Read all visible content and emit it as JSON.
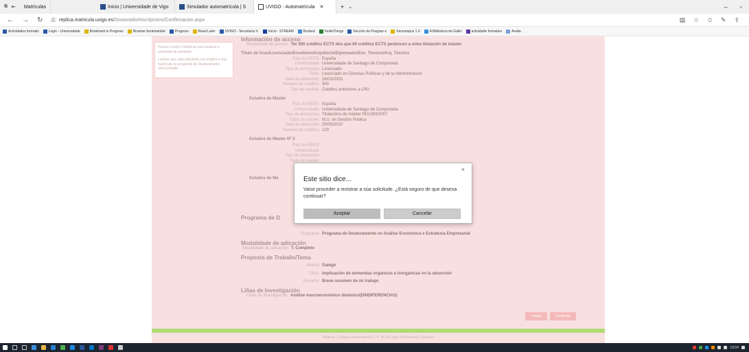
{
  "browser": {
    "tabs": [
      {
        "label": "Matrículas",
        "active": false
      },
      {
        "label": "Inicio | Universidade de Vigo",
        "active": false
      },
      {
        "label": "Simulador automatrícula | S",
        "active": false
      },
      {
        "label": "UVIGO - Automatrícula",
        "active": true
      }
    ],
    "url_host": "replica.matricula.uvigo.es",
    "url_path": "/Doutorado/Inscripcions/Confirmacion.aspx",
    "favorites": [
      "Actividades formativ",
      "Login - Universidade",
      "Bookmark in Progress",
      "Browser bookmarklet",
      "Progress",
      "Read Later",
      "UVIGO - Secretaría V.",
      "Inicio - STREAM",
      "Booked",
      "FeideThings",
      "Sección de Posgrao e",
      "Xescampus 1.0",
      "A Biblioteca de Galici",
      "actividade formativa",
      "Avalia"
    ]
  },
  "sidebar": {
    "text1": "Prema o botón Confirmar para realizar a solicitude de admisión.",
    "text2": "Lembre que esta solicitude non implica a súa matrícula no programa de Doutoramento seleccionado."
  },
  "main": {
    "access_title": "Información de acceso",
    "access_mode_label": "Modalidade de acceso:",
    "access_mode_value": "Ter 300 créditos ECTS dos que 60 créditos ECTS pertencen a unha titulación de máster",
    "grade_title": "Título de Grao/Licenciado/Enxeñeiro/Arquitecto/Diplomado/Enx. Técnico/Arq. Técnico",
    "grade_rows": [
      {
        "label": "País do EEES:",
        "value": "España"
      },
      {
        "label": "Universidade:",
        "value": "Universidade de Santiago de Compostela"
      },
      {
        "label": "Tipo de ensinanza:",
        "value": "Licenciado"
      },
      {
        "label": "Título:",
        "value": "Licenciado en Ciencias Políticas y de la Administración"
      },
      {
        "label": "Data de obtención:",
        "value": "26/03/2003"
      },
      {
        "label": "Número de créditos:",
        "value": "300"
      },
      {
        "label": "Tipo de medida:",
        "value": "Créditos anteriores a LRU"
      }
    ],
    "master_title": "Estudos de Máster",
    "master_rows": [
      {
        "label": "País do EEES:",
        "value": "España"
      },
      {
        "label": "Universidade:",
        "value": "Universidade de Santiago de Compostela"
      },
      {
        "label": "Tipo de ensinanza:",
        "value": "Titulacións de máster RD1393/2007"
      },
      {
        "label": "Título do máster:",
        "value": "M.U. en Gestión Pública"
      },
      {
        "label": "Data de obtención:",
        "value": "20/05/2010"
      },
      {
        "label": "Número de créditos:",
        "value": "120"
      }
    ],
    "master2_title": "Estudos de Máster Nº 2",
    "master2_rows": [
      {
        "label": "País do EEES:",
        "value": ""
      },
      {
        "label": "Universidade:",
        "value": ""
      },
      {
        "label": "Tipo de ensinanza:",
        "value": ""
      },
      {
        "label": "Título do máster:",
        "value": ""
      }
    ],
    "master3_title": "Estudos de Má",
    "program_title": "Programa de D",
    "program_label": "Programa:",
    "program_value": "Programa de Doutoramento en Análise Económica e Estratexia Empresarial",
    "modality_title": "Modalidade de adicación",
    "modality_label": "Modalidade de adicación:",
    "modality_value": "T. Completo",
    "proposal_title": "Proposta de Traballo/Tema",
    "proposal_rows": [
      {
        "label": "Idioma:",
        "value": "Galego"
      },
      {
        "label": "Título:",
        "value": "Implicación de enmendas orgánicas e inorgánicas en la absorción"
      },
      {
        "label": "Resumo:",
        "value": "Breve resumen de mi trabajo"
      }
    ],
    "research_title": "Liñas de Investigación",
    "research_label": "Liñas de Investigación:",
    "research_value": "Análise macroeconómico dinámico(DINDIFERENCIAS)",
    "back_label": "« Atrás",
    "confirm_label": "Confirmar",
    "footer": "Reitoría | Campus Universitario | C.P. 36.310 Vigo (Pontevedra) | España"
  },
  "dialog": {
    "title": "Este sitio dice...",
    "message": "Vaise proceder a rexistrar a súa solicitude. ¿Está seguro de que desexa continuar?",
    "ok_label": "Aceptar",
    "cancel_label": "Cancelar",
    "close_symbol": "×"
  },
  "taskbar": {
    "clock": "19:04"
  }
}
